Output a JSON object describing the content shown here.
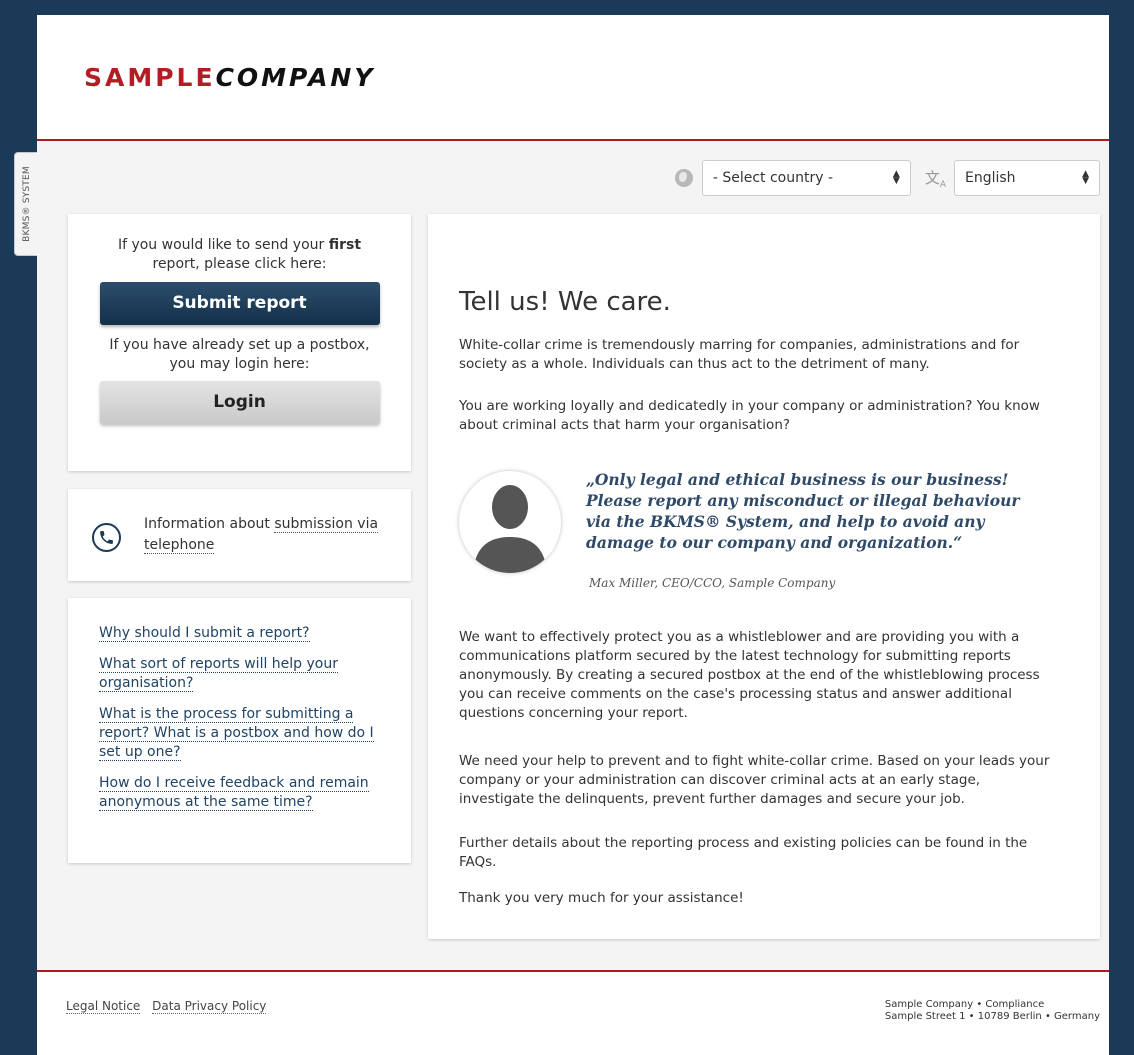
{
  "side_tab": {
    "label": "BKMS® SYSTEM"
  },
  "logo": {
    "part1": "SAMPLE",
    "part2": "COMPANY"
  },
  "selectors": {
    "country": "- Select country -",
    "language": "English"
  },
  "submit_card": {
    "intro_1": "If you would like to send your",
    "intro_bold": "first",
    "intro_2": "report, please click here:",
    "submit_label": "Submit report",
    "login_intro": "If you have already set up a postbox, you may login here:",
    "login_label": "Login"
  },
  "phone_card": {
    "text": "Information about",
    "link": "submission via telephone"
  },
  "faq": [
    "Why should I submit a report?",
    "What sort of reports will help your organisation?",
    "What is the process for submitting a report? What is a postbox and how do I set up one?",
    "How do I receive feedback and remain anonymous at the same time?"
  ],
  "main": {
    "title": "Tell us! We care.",
    "p1": "White-collar crime is tremendously marring for companies, administrations and for society as a whole. Individuals can thus act to the detriment of many.",
    "p2": "You are working loyally and dedicatedly in your company or administration? You know about criminal acts that harm your organisation?",
    "quote": "„Only legal and ethical business is our business! Please report any misconduct or illegal behaviour via the BKMS® System, and help to avoid any damage to our company and organization.“",
    "quote_author": "Max Miller, CEO/CCO, Sample Company",
    "p3": "We want to effectively protect you as a whistleblower and are providing you with a communications platform secured by the latest technology for submitting reports anonymously. By creating a secured postbox at the end of the whistleblowing process you can receive comments on the case's processing status and answer additional questions concerning your report.",
    "p4": "We need your help to prevent and to fight white-collar crime. Based on your leads your company or your administration can discover criminal acts at an early stage, investigate the delinquents, prevent further damages and secure your job.",
    "p5": "Further details about the reporting process and existing policies can be found in the FAQs.",
    "p6": "Thank you very much for your assistance!"
  },
  "footer": {
    "legal": "Legal Notice",
    "privacy": "Data Privacy Policy",
    "address_1": "Sample Company  • Compliance",
    "address_2": "Sample Street 1  • 10789 Berlin  • Germany"
  }
}
